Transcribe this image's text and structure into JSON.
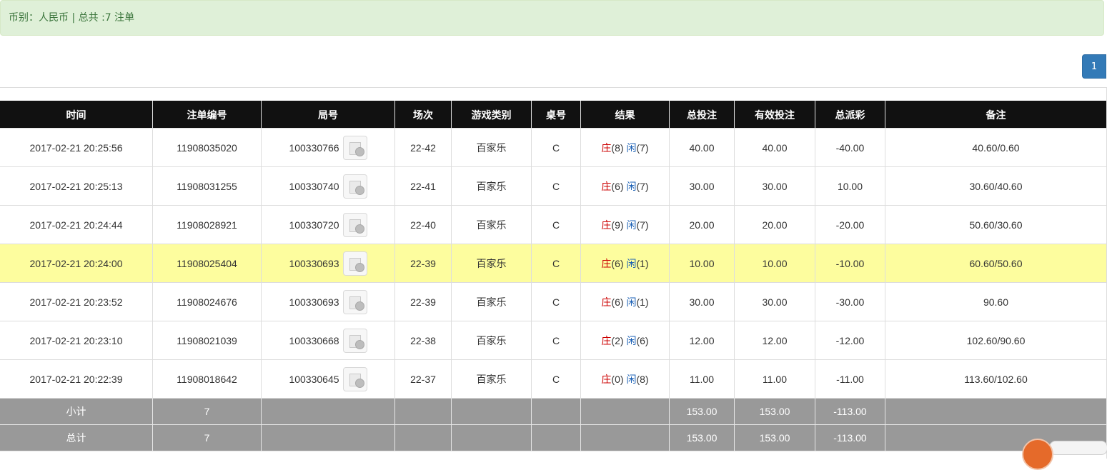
{
  "info": {
    "currency_label": "币别：人民币 | 总共 :7 注单"
  },
  "pagination": {
    "current_page": "1"
  },
  "table": {
    "headers": [
      "时间",
      "注单编号",
      "局号",
      "场次",
      "游戏类别",
      "桌号",
      "结果",
      "总投注",
      "有效投注",
      "总派彩",
      "备注"
    ],
    "rows": [
      {
        "time": "2017-02-21 20:25:56",
        "bet_id": "11908035020",
        "round": "100330766",
        "shoe": "22-42",
        "game": "百家乐",
        "table": "C",
        "banker": "庄",
        "banker_pts": "(8)",
        "player": "闲",
        "player_pts": "(7)",
        "total_bet": "40.00",
        "valid_bet": "40.00",
        "payout": "-40.00",
        "remark": "40.60/0.60"
      },
      {
        "time": "2017-02-21 20:25:13",
        "bet_id": "11908031255",
        "round": "100330740",
        "shoe": "22-41",
        "game": "百家乐",
        "table": "C",
        "banker": "庄",
        "banker_pts": "(6)",
        "player": "闲",
        "player_pts": "(7)",
        "total_bet": "30.00",
        "valid_bet": "30.00",
        "payout": "10.00",
        "remark": "30.60/40.60"
      },
      {
        "time": "2017-02-21 20:24:44",
        "bet_id": "11908028921",
        "round": "100330720",
        "shoe": "22-40",
        "game": "百家乐",
        "table": "C",
        "banker": "庄",
        "banker_pts": "(9)",
        "player": "闲",
        "player_pts": "(7)",
        "total_bet": "20.00",
        "valid_bet": "20.00",
        "payout": "-20.00",
        "remark": "50.60/30.60"
      },
      {
        "time": "2017-02-21 20:24:00",
        "bet_id": "11908025404",
        "round": "100330693",
        "shoe": "22-39",
        "game": "百家乐",
        "table": "C",
        "banker": "庄",
        "banker_pts": "(6)",
        "player": "闲",
        "player_pts": "(1)",
        "total_bet": "10.00",
        "valid_bet": "10.00",
        "payout": "-10.00",
        "remark": "60.60/50.60"
      },
      {
        "time": "2017-02-21 20:23:52",
        "bet_id": "11908024676",
        "round": "100330693",
        "shoe": "22-39",
        "game": "百家乐",
        "table": "C",
        "banker": "庄",
        "banker_pts": "(6)",
        "player": "闲",
        "player_pts": "(1)",
        "total_bet": "30.00",
        "valid_bet": "30.00",
        "payout": "-30.00",
        "remark": "90.60"
      },
      {
        "time": "2017-02-21 20:23:10",
        "bet_id": "11908021039",
        "round": "100330668",
        "shoe": "22-38",
        "game": "百家乐",
        "table": "C",
        "banker": "庄",
        "banker_pts": "(2)",
        "player": "闲",
        "player_pts": "(6)",
        "total_bet": "12.00",
        "valid_bet": "12.00",
        "payout": "-12.00",
        "remark": "102.60/90.60"
      },
      {
        "time": "2017-02-21 20:22:39",
        "bet_id": "11908018642",
        "round": "100330645",
        "shoe": "22-37",
        "game": "百家乐",
        "table": "C",
        "banker": "庄",
        "banker_pts": "(0)",
        "player": "闲",
        "player_pts": "(8)",
        "total_bet": "11.00",
        "valid_bet": "11.00",
        "payout": "-11.00",
        "remark": "113.60/102.60"
      }
    ],
    "subtotal": {
      "label": "小计",
      "count": "7",
      "total_bet": "153.00",
      "valid_bet": "153.00",
      "payout": "-113.00"
    },
    "grand_total": {
      "label": "总计",
      "count": "7",
      "total_bet": "153.00",
      "valid_bet": "153.00",
      "payout": "-113.00"
    }
  },
  "icons": {
    "replay": "video-replay-icon"
  },
  "colors": {
    "header_bg": "#111111",
    "highlight_row": "#fdfd9e",
    "info_bg": "#dff0d8",
    "pager_active": "#337ab7",
    "negative": "#ee0000",
    "bet_blue": "#1a5fb4",
    "banker_red": "#cc0000",
    "summary_bg": "#999999"
  }
}
